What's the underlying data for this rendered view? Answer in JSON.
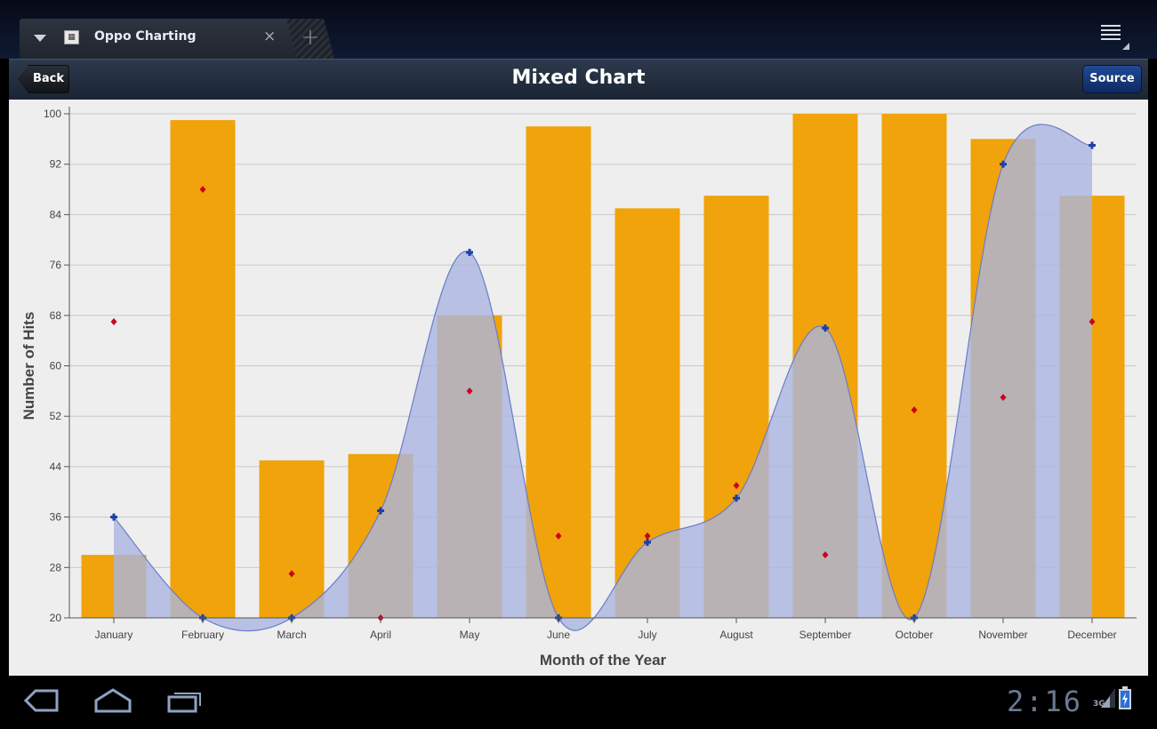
{
  "browser": {
    "tab_title": "Oppo Charting",
    "tab_close": "×",
    "new_tab": "+"
  },
  "header": {
    "back_label": "Back",
    "title": "Mixed Chart",
    "source_label": "Source"
  },
  "system": {
    "time": "2:16",
    "network": "3G"
  },
  "colors": {
    "bar": "#f0a30a",
    "area_fill": "#aab5e0",
    "area_line": "#6a7cc8",
    "area_marker": "#1a3fa8",
    "scatter": "#cc0022",
    "grid": "#c8c8c8"
  },
  "chart_data": {
    "type": "mixed",
    "xlabel": "Month of the Year",
    "ylabel": "Number of Hits",
    "ylim": [
      20,
      100
    ],
    "yticks": [
      20,
      28,
      36,
      44,
      52,
      60,
      68,
      76,
      84,
      92,
      100
    ],
    "categories": [
      "January",
      "February",
      "March",
      "April",
      "May",
      "June",
      "July",
      "August",
      "September",
      "October",
      "November",
      "December"
    ],
    "series": [
      {
        "type": "bar",
        "values": [
          30,
          99,
          45,
          46,
          68,
          98,
          85,
          87,
          100,
          100,
          96,
          87
        ]
      },
      {
        "type": "area",
        "smooth": true,
        "values": [
          36,
          20,
          20,
          37,
          78,
          20,
          32,
          39,
          66,
          20,
          92,
          95
        ]
      },
      {
        "type": "scatter",
        "values": [
          67,
          88,
          27,
          20,
          56,
          33,
          33,
          41,
          30,
          53,
          55,
          67
        ]
      }
    ],
    "grid": true
  }
}
